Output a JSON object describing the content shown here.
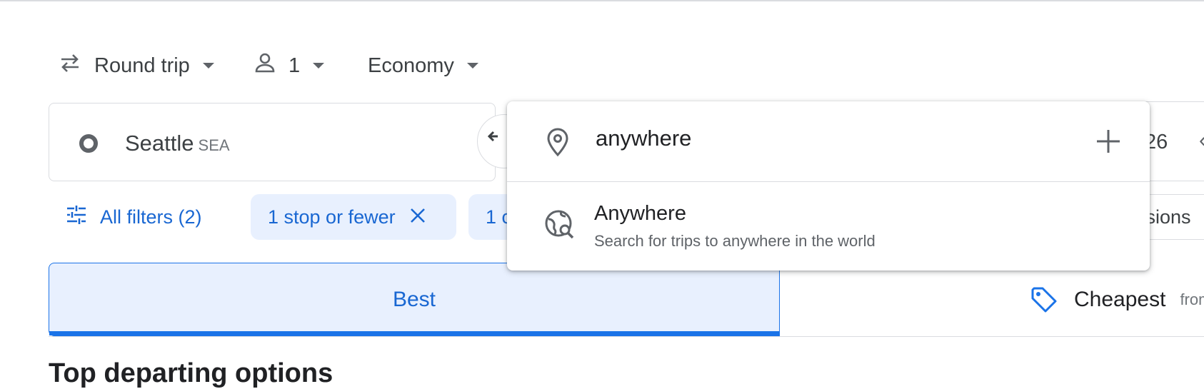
{
  "options": {
    "trip_type": "Round trip",
    "passengers": "1",
    "cabin": "Economy"
  },
  "origin": {
    "city": "Seattle",
    "code": "SEA"
  },
  "date_partial": "26",
  "filters": {
    "all_filters": "All filters (2)",
    "chip_stops": "1 stop or fewer",
    "chip_partial": "1 c",
    "chip_right_partial": "ssions"
  },
  "tabs": {
    "best": "Best",
    "cheapest": "Cheapest",
    "cheapest_from": "from"
  },
  "heading": "Top departing options",
  "dropdown": {
    "input_value": "anywhere",
    "suggestion_title": "Anywhere",
    "suggestion_subtitle": "Search for trips to anywhere in the world"
  },
  "colors": {
    "accent": "#1a73e8",
    "chip_bg": "#e8f0fe",
    "text": "#3c4043"
  }
}
